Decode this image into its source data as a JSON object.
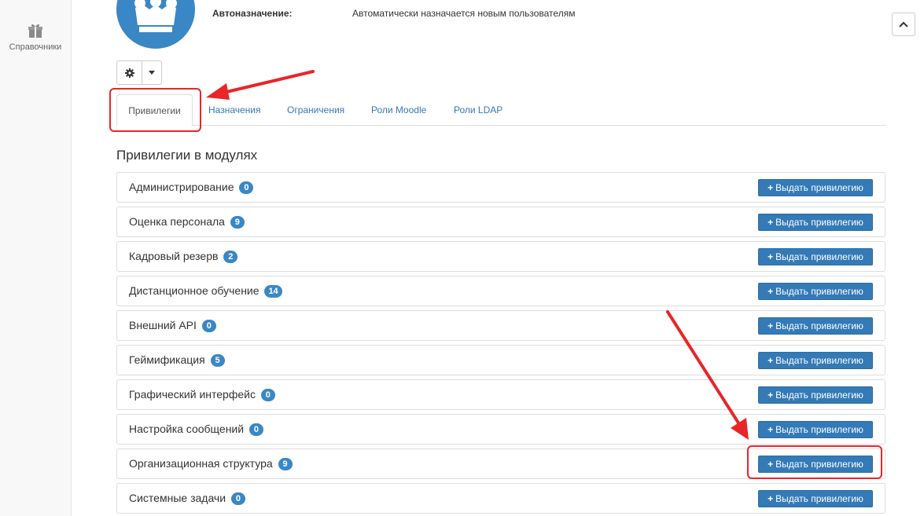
{
  "sidebar": {
    "items": [
      {
        "label": "Справочники",
        "icon": "gift-icon"
      }
    ]
  },
  "profile": {
    "autoassign_label": "Автоназначение:",
    "autoassign_value": "Автоматически назначается новым пользователям"
  },
  "tabs": [
    {
      "label": "Привилегии",
      "active": true
    },
    {
      "label": "Назначения",
      "active": false
    },
    {
      "label": "Ограничения",
      "active": false
    },
    {
      "label": "Роли Moodle",
      "active": false
    },
    {
      "label": "Роли LDAP",
      "active": false
    }
  ],
  "section_title": "Привилегии в модулях",
  "grant_label": "Выдать привилегию",
  "modules": [
    {
      "name": "Администрирование",
      "count": "0"
    },
    {
      "name": "Оценка персонала",
      "count": "9"
    },
    {
      "name": "Кадровый резерв",
      "count": "2"
    },
    {
      "name": "Дистанционное обучение",
      "count": "14"
    },
    {
      "name": "Внешний API",
      "count": "0"
    },
    {
      "name": "Геймификация",
      "count": "5"
    },
    {
      "name": "Графический интерфейс",
      "count": "0"
    },
    {
      "name": "Настройка сообщений",
      "count": "0"
    },
    {
      "name": "Организационная структура",
      "count": "9"
    },
    {
      "name": "Системные задачи",
      "count": "0"
    }
  ],
  "colors": {
    "primary": "#337ab7",
    "badge": "#3a87c5",
    "annotation": "#e8262a"
  }
}
